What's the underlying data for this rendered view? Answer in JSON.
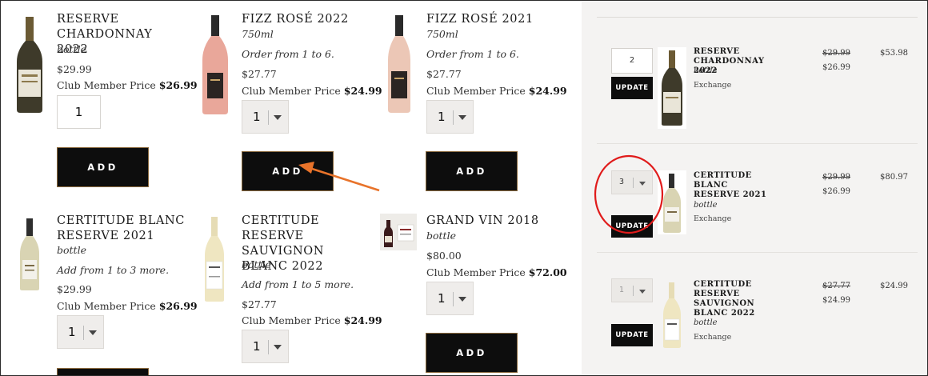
{
  "products": [
    {
      "name": "RESERVE CHARDONNAY 2022",
      "unit": "bottle",
      "note": "",
      "price": "$29.99",
      "club_label": "Club Member Price",
      "club_price": "$26.99",
      "qty": "1",
      "qty_type": "input",
      "add_label": "ADD"
    },
    {
      "name": "FIZZ ROSÉ 2022",
      "unit": "750ml",
      "note": "Order from 1 to 6.",
      "price": "$27.77",
      "club_label": "Club Member Price",
      "club_price": "$24.99",
      "qty": "1",
      "qty_type": "select",
      "add_label": "ADD"
    },
    {
      "name": "FIZZ ROSÉ 2021",
      "unit": "750ml",
      "note": "Order from 1 to 6.",
      "price": "$27.77",
      "club_label": "Club Member Price",
      "club_price": "$24.99",
      "qty": "1",
      "qty_type": "select",
      "add_label": "ADD"
    },
    {
      "name": "CERTITUDE BLANC RESERVE 2021",
      "unit": "bottle",
      "note": "Add from 1 to 3 more.",
      "price": "$29.99",
      "club_label": "Club Member Price",
      "club_price": "$26.99",
      "qty": "1",
      "qty_type": "select",
      "add_label": ""
    },
    {
      "name": "CERTITUDE RESERVE SAUVIGNON BLANC 2022",
      "unit": "bottle",
      "note": "Add from 1 to 5 more.",
      "price": "$27.77",
      "club_label": "Club Member Price",
      "club_price": "$24.99",
      "qty": "1",
      "qty_type": "select",
      "add_label": ""
    },
    {
      "name": "GRAND VIN 2018",
      "unit": "bottle",
      "note": "",
      "price": "$80.00",
      "club_label": "Club Member Price",
      "club_price": "$72.00",
      "qty": "1",
      "qty_type": "select",
      "add_label": "ADD"
    }
  ],
  "cart": {
    "items": [
      {
        "qty": "2",
        "qty_type": "input",
        "update_label": "UPDATE",
        "name": "RESERVE CHARDONNAY 2022",
        "unit": "bottle",
        "exchange": "Exchange",
        "old_price": "$29.99",
        "new_price": "$26.99",
        "total": "$53.98"
      },
      {
        "qty": "3",
        "qty_type": "select",
        "update_label": "UPDATE",
        "name": "CERTITUDE BLANC RESERVE 2021",
        "unit": "bottle",
        "exchange": "Exchange",
        "old_price": "$29.99",
        "new_price": "$26.99",
        "total": "$80.97"
      },
      {
        "qty": "1",
        "qty_type": "select",
        "update_label": "UPDATE",
        "name": "CERTITUDE RESERVE SAUVIGNON BLANC 2022",
        "unit": "bottle",
        "exchange": "Exchange",
        "old_price": "$27.77",
        "new_price": "$24.99",
        "total": "$24.99"
      }
    ]
  },
  "colors": {
    "button_bg": "#0d0d0d",
    "button_border": "#8b6a3e",
    "cart_bg": "#f4f3f2",
    "annotation_arrow": "#e8732a",
    "annotation_circle": "#e01b1b"
  },
  "icons": {
    "select_caret": "chevron-down-icon",
    "bottle": "wine-bottle-image"
  }
}
